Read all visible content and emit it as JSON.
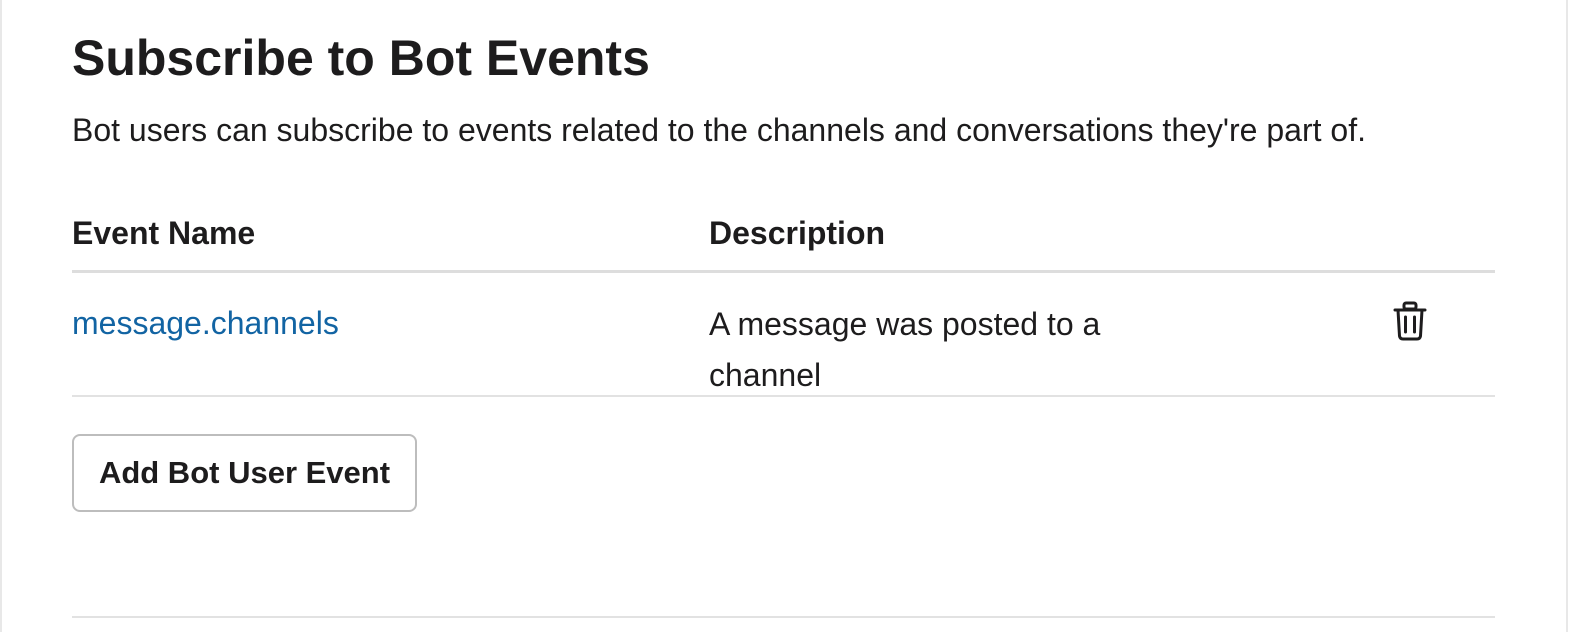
{
  "section": {
    "title": "Subscribe to Bot Events",
    "subtitle": "Bot users can subscribe to events related to the channels and conversations they're part of."
  },
  "table": {
    "headers": {
      "event_name": "Event Name",
      "description": "Description"
    },
    "rows": [
      {
        "event_name": "message.channels",
        "description": "A message was posted to a channel",
        "action_icon": "trash-icon"
      }
    ]
  },
  "actions": {
    "add_button_label": "Add Bot User Event"
  },
  "colors": {
    "link": "#1264a3",
    "text": "#1d1c1d",
    "divider": "#e2e2e2",
    "button_border": "#bdbdbd"
  }
}
